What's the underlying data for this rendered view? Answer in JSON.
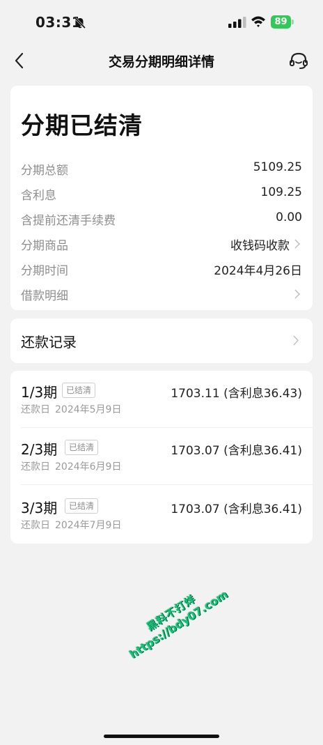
{
  "status_bar": {
    "time": "03:31",
    "battery": "89",
    "icons": [
      "bell-off-icon",
      "signal-icon",
      "wifi-icon",
      "battery-icon"
    ],
    "battery_color": "#34c759"
  },
  "nav": {
    "title": "交易分期明细详情",
    "back_icon": "chevron-left-icon",
    "service_icon": "headset-icon"
  },
  "summary": {
    "status": "分期已结清",
    "rows": [
      {
        "label": "分期总额",
        "value": "5109.25"
      },
      {
        "label": "含利息",
        "value": "109.25"
      },
      {
        "label": "含提前还清手续费",
        "value": "0.00"
      },
      {
        "label": "分期商品",
        "value": "收钱码收款"
      },
      {
        "label": "分期时间",
        "value": "2024年4月26日"
      },
      {
        "label": "借款明细",
        "value": ""
      }
    ]
  },
  "repayment_records": {
    "label": "还款记录"
  },
  "installments": [
    {
      "period": "1/3期",
      "status": "已结清",
      "amount": "1703.11 (含利息36.43)",
      "due_label": "还款日",
      "due_date": "2024年5月9日"
    },
    {
      "period": "2/3期",
      "status": "已结清",
      "amount": "1703.07 (含利息36.41)",
      "due_label": "还款日",
      "due_date": "2024年6月9日"
    },
    {
      "period": "3/3期",
      "status": "已结清",
      "amount": "1703.07 (含利息36.41)",
      "due_label": "还款日",
      "due_date": "2024年7月9日"
    }
  ],
  "watermark": {
    "line1": "黑料不打烊",
    "line2": "https://bdy07.com"
  },
  "colors": {
    "background": "#f2f2f2",
    "card": "#ffffff",
    "secondary_text": "#8e8e8e",
    "watermark": "#19c37d"
  }
}
